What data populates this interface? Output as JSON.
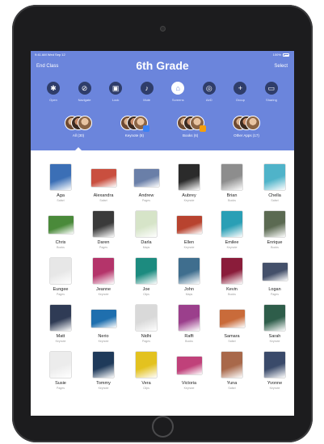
{
  "status_bar": {
    "left": "9:41 AM  Wed Sep 12",
    "right": "100%"
  },
  "nav": {
    "left_label": "End Class",
    "title": "6th Grade",
    "right_label": "Select"
  },
  "toolbar": [
    {
      "label": "Open",
      "icon": "app-launch-icon",
      "glyph": "✱"
    },
    {
      "label": "Navigate",
      "icon": "compass-icon",
      "glyph": "⊘"
    },
    {
      "label": "Lock",
      "icon": "lock-icon",
      "glyph": "▣"
    },
    {
      "label": "Mute",
      "icon": "mute-icon",
      "glyph": "♪"
    },
    {
      "label": "Screens",
      "icon": "screens-icon",
      "glyph": "⌂"
    },
    {
      "label": "AirD",
      "icon": "airdrop-icon",
      "glyph": "◎"
    },
    {
      "label": "Group",
      "icon": "add-group-icon",
      "glyph": "+"
    },
    {
      "label": "Sharing",
      "icon": "screen-sharing-icon",
      "glyph": "▭"
    }
  ],
  "filters": [
    {
      "label": "All (30)",
      "badge_color": ""
    },
    {
      "label": "Keynote (8)",
      "badge_color": "#3b82f6"
    },
    {
      "label": "Books (6)",
      "badge_color": "#f59e0b"
    },
    {
      "label": "Other Apps (17)",
      "badge_color": ""
    }
  ],
  "students": [
    {
      "name": "Aga",
      "app": "Safari",
      "color": "#3b6fb6",
      "wide": false
    },
    {
      "name": "Alexandra",
      "app": "Safari",
      "color": "#c94f3f",
      "wide": true
    },
    {
      "name": "Andrew",
      "app": "Pages",
      "color": "#6a7fa8",
      "wide": true
    },
    {
      "name": "Aubrey",
      "app": "Keynote",
      "color": "#2b2b2b",
      "wide": false
    },
    {
      "name": "Brian",
      "app": "Books",
      "color": "#8d8d8d",
      "wide": false
    },
    {
      "name": "Chella",
      "app": "Safari",
      "color": "#4fb3c9",
      "wide": false
    },
    {
      "name": "Chris",
      "app": "Books",
      "color": "#4a8a3a",
      "wide": true
    },
    {
      "name": "Daren",
      "app": "Pages",
      "color": "#3a3a3a",
      "wide": false
    },
    {
      "name": "Darla",
      "app": "Maps",
      "color": "#d6e4c8",
      "wide": false
    },
    {
      "name": "Ellen",
      "app": "Keynote",
      "color": "#b8432f",
      "wide": true
    },
    {
      "name": "Emilee",
      "app": "Keynote",
      "color": "#2a9fb5",
      "wide": false
    },
    {
      "name": "Enrique",
      "app": "Books",
      "color": "#5b6a52",
      "wide": false
    },
    {
      "name": "Eungee",
      "app": "Pages",
      "color": "#e7e7e7",
      "wide": false
    },
    {
      "name": "Jeanne",
      "app": "Keynote",
      "color": "#b4346a",
      "wide": false
    },
    {
      "name": "Joe",
      "app": "Clips",
      "color": "#1c8b7f",
      "wide": false
    },
    {
      "name": "John",
      "app": "Maps",
      "color": "#3f6e8e",
      "wide": false
    },
    {
      "name": "Kevin",
      "app": "Books",
      "color": "#8a1c3a",
      "wide": false
    },
    {
      "name": "Logan",
      "app": "Pages",
      "color": "#44506a",
      "wide": true
    },
    {
      "name": "Matt",
      "app": "Keynote",
      "color": "#2f3b55",
      "wide": false
    },
    {
      "name": "Nerio",
      "app": "Keynote",
      "color": "#1f6fae",
      "wide": true
    },
    {
      "name": "Nidhi",
      "app": "Pages",
      "color": "#d9d9d9",
      "wide": false
    },
    {
      "name": "Raffi",
      "app": "Books",
      "color": "#9b3f8c",
      "wide": false
    },
    {
      "name": "Samara",
      "app": "Safari",
      "color": "#c96b3a",
      "wide": true
    },
    {
      "name": "Sarah",
      "app": "Keynote",
      "color": "#2e5d4a",
      "wide": false
    },
    {
      "name": "Susie",
      "app": "Pages",
      "color": "#ececec",
      "wide": false
    },
    {
      "name": "Tommy",
      "app": "Keynote",
      "color": "#1f3a5a",
      "wide": false
    },
    {
      "name": "Vera",
      "app": "Clips",
      "color": "#e3c21f",
      "wide": false
    },
    {
      "name": "Victoria",
      "app": "Keynote",
      "color": "#c0417a",
      "wide": true
    },
    {
      "name": "Yuna",
      "app": "Safari",
      "color": "#a8684a",
      "wide": false
    },
    {
      "name": "Yvonne",
      "app": "Keynote",
      "color": "#3a4a6a",
      "wide": false
    }
  ]
}
